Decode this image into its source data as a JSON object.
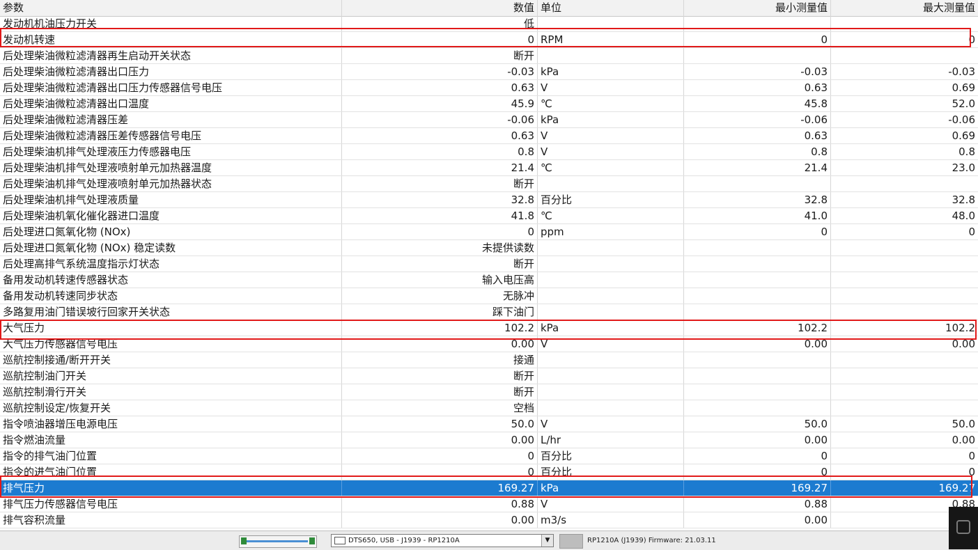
{
  "header": {
    "param": "参数",
    "value": "数值",
    "unit": "单位",
    "min": "最小测量值",
    "max": "最大测量值"
  },
  "rows": [
    {
      "p": "发动机机油压力开关",
      "v": "低",
      "u": "",
      "mn": "",
      "mx": ""
    },
    {
      "p": "发动机转速",
      "v": "0",
      "u": "RPM",
      "mn": "0",
      "mx": "0"
    },
    {
      "p": "后处理柴油微粒滤清器再生启动开关状态",
      "v": "断开",
      "u": "",
      "mn": "",
      "mx": ""
    },
    {
      "p": "后处理柴油微粒滤清器出口压力",
      "v": "-0.03",
      "u": "kPa",
      "mn": "-0.03",
      "mx": "-0.03"
    },
    {
      "p": "后处理柴油微粒滤清器出口压力传感器信号电压",
      "v": "0.63",
      "u": "V",
      "mn": "0.63",
      "mx": "0.69"
    },
    {
      "p": "后处理柴油微粒滤清器出口温度",
      "v": "45.9",
      "u": "℃",
      "mn": "45.8",
      "mx": "52.0"
    },
    {
      "p": "后处理柴油微粒滤清器压差",
      "v": "-0.06",
      "u": "kPa",
      "mn": "-0.06",
      "mx": "-0.06"
    },
    {
      "p": "后处理柴油微粒滤清器压差传感器信号电压",
      "v": "0.63",
      "u": "V",
      "mn": "0.63",
      "mx": "0.69"
    },
    {
      "p": "后处理柴油机排气处理液压力传感器电压",
      "v": "0.8",
      "u": "V",
      "mn": "0.8",
      "mx": "0.8"
    },
    {
      "p": "后处理柴油机排气处理液喷射单元加热器温度",
      "v": "21.4",
      "u": "℃",
      "mn": "21.4",
      "mx": "23.0"
    },
    {
      "p": "后处理柴油机排气处理液喷射单元加热器状态",
      "v": "断开",
      "u": "",
      "mn": "",
      "mx": ""
    },
    {
      "p": "后处理柴油机排气处理液质量",
      "v": "32.8",
      "u": "百分比",
      "mn": "32.8",
      "mx": "32.8"
    },
    {
      "p": "后处理柴油机氧化催化器进口温度",
      "v": "41.8",
      "u": "℃",
      "mn": "41.0",
      "mx": "48.0"
    },
    {
      "p": "后处理进口氮氧化物 (NOx)",
      "v": "0",
      "u": "ppm",
      "mn": "0",
      "mx": "0"
    },
    {
      "p": "后处理进口氮氧化物 (NOx) 稳定读数",
      "v": "未提供读数",
      "u": "",
      "mn": "",
      "mx": ""
    },
    {
      "p": "后处理高排气系统温度指示灯状态",
      "v": "断开",
      "u": "",
      "mn": "",
      "mx": ""
    },
    {
      "p": "备用发动机转速传感器状态",
      "v": "输入电压高",
      "u": "",
      "mn": "",
      "mx": ""
    },
    {
      "p": "备用发动机转速同步状态",
      "v": "无脉冲",
      "u": "",
      "mn": "",
      "mx": ""
    },
    {
      "p": "多路复用油门错误坡行回家开关状态",
      "v": "踩下油门",
      "u": "",
      "mn": "",
      "mx": ""
    },
    {
      "p": "大气压力",
      "v": "102.2",
      "u": "kPa",
      "mn": "102.2",
      "mx": "102.2"
    },
    {
      "p": "大气压力传感器信号电压",
      "v": "0.00",
      "u": "V",
      "mn": "0.00",
      "mx": "0.00"
    },
    {
      "p": "巡航控制接通/断开开关",
      "v": "接通",
      "u": "",
      "mn": "",
      "mx": ""
    },
    {
      "p": "巡航控制油门开关",
      "v": "断开",
      "u": "",
      "mn": "",
      "mx": ""
    },
    {
      "p": "巡航控制滑行开关",
      "v": "断开",
      "u": "",
      "mn": "",
      "mx": ""
    },
    {
      "p": "巡航控制设定/恢复开关",
      "v": "空档",
      "u": "",
      "mn": "",
      "mx": ""
    },
    {
      "p": "指令喷油器增压电源电压",
      "v": "50.0",
      "u": "V",
      "mn": "50.0",
      "mx": "50.0"
    },
    {
      "p": "指令燃油流量",
      "v": "0.00",
      "u": "L/hr",
      "mn": "0.00",
      "mx": "0.00"
    },
    {
      "p": "指令的排气油门位置",
      "v": "0",
      "u": "百分比",
      "mn": "0",
      "mx": "0"
    },
    {
      "p": "指令的进气油门位置",
      "v": "0",
      "u": "百分比",
      "mn": "0",
      "mx": "0"
    },
    {
      "p": "排气压力",
      "v": "169.27",
      "u": "kPa",
      "mn": "169.27",
      "mx": "169.27",
      "selected": true
    },
    {
      "p": "排气压力传感器信号电压",
      "v": "0.88",
      "u": "V",
      "mn": "0.88",
      "mx": "0.88"
    },
    {
      "p": "排气容积流量",
      "v": "0.00",
      "u": "m3/s",
      "mn": "0.00",
      "mx": ""
    }
  ],
  "statusbar": {
    "device": "DTS650, USB - J1939 - RP1210A",
    "firmware": "RP1210A (J1939)  Firmware: 21.03.11"
  }
}
